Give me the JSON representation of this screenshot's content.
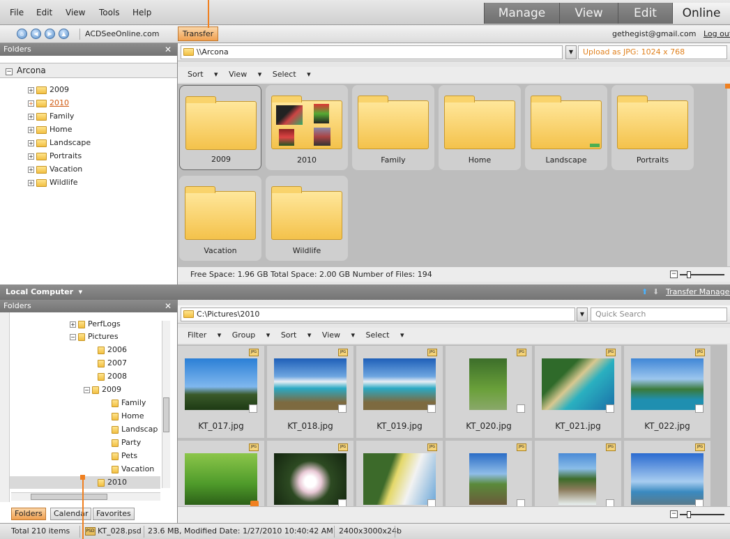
{
  "menu": [
    "File",
    "Edit",
    "View",
    "Tools",
    "Help"
  ],
  "modes": [
    "Manage",
    "View",
    "Edit",
    "Online"
  ],
  "active_mode": "Online",
  "nav": {
    "site": "ACDSeeOnline.com",
    "transfer_label": "Transfer",
    "email": "gethegist@gmail.com",
    "logout": "Log out"
  },
  "top_folders_panel": {
    "title": "Folders",
    "root": "Arcona",
    "items": [
      "2009",
      "2010",
      "Family",
      "Home",
      "Landscape",
      "Portraits",
      "Vacation",
      "Wildlife"
    ],
    "selected": "2010"
  },
  "top_main": {
    "path": "\\\\Arcona",
    "upload": "Upload as JPG: 1024 x 768",
    "toolbar": [
      "Sort",
      "View",
      "Select"
    ],
    "folders": [
      "2009",
      "2010",
      "Family",
      "Home",
      "Landscape",
      "Portraits",
      "Vacation",
      "Wildlife"
    ],
    "info": "Free Space: 1.96 GB  Total Space: 2.00 GB  Number of Files: 194"
  },
  "midbar": {
    "title": "Local Computer",
    "transfer_manager": "Transfer Manager"
  },
  "bottom_folders_panel": {
    "title": "Folders",
    "items": [
      "PerfLogs",
      "Pictures",
      "2006",
      "2007",
      "2008",
      "2009",
      "Family",
      "Home",
      "Landscap",
      "Party",
      "Pets",
      "Vacation",
      "2010"
    ],
    "tabs": [
      "Folders",
      "Calendar",
      "Favorites"
    ],
    "active_tab": "Folders"
  },
  "bottom_main": {
    "path": "C:\\Pictures\\2010",
    "search_placeholder": "Quick Search",
    "toolbar": [
      "Filter",
      "Group",
      "Sort",
      "View",
      "Select"
    ],
    "files": [
      "KT_017.jpg",
      "KT_018.jpg",
      "KT_019.jpg",
      "KT_020.jpg",
      "KT_021.jpg",
      "KT_022.jpg"
    ],
    "row2_count": 6,
    "jpg_tag": "JPG"
  },
  "status": {
    "items": "Total 210 items",
    "file": "KT_028.psd",
    "details": "23.6 MB, Modified Date: 1/27/2010 10:40:42 AM",
    "dims": "2400x3000x24b",
    "psd_tag": "PSD"
  },
  "colors": {
    "accent": "#f08020",
    "folder": "#f4c24b",
    "dark_bar": "#7a7a7a"
  },
  "icons": [
    "home-icon",
    "back-icon",
    "forward-icon",
    "up-icon",
    "folder-icon",
    "close-icon",
    "chevron-down-icon",
    "plus-icon",
    "minus-icon",
    "arrow-up-icon",
    "arrow-down-icon",
    "zoom-slider"
  ]
}
